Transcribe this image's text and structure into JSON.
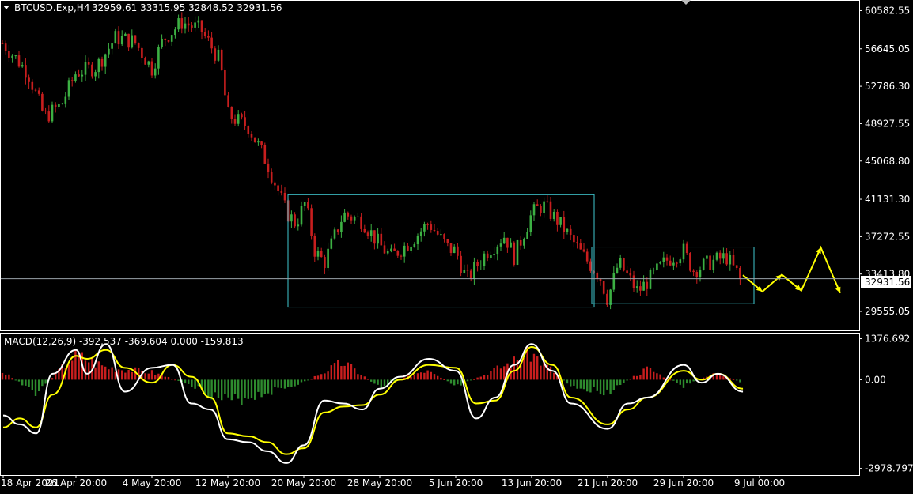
{
  "header": {
    "symbol_timeframe": "BTCUSD.Exp,H4",
    "ohlc": "32959.61 33315.95 32848.52 32931.56"
  },
  "macd_header": "MACD(12,26,9) -392.537 -369.604 0.000 -159.813",
  "current_price_label": "32931.56",
  "colors": {
    "background": "#000000",
    "up_candle": "#3cb043",
    "down_candle": "#c81e1e",
    "frame": "#ffffff",
    "box": "#40c8d0",
    "macd_main": "#ffffff",
    "macd_signal": "#ffff00",
    "hist_pos": "#c81e1e",
    "hist_neg": "#2e8b2e",
    "projection": "#ffff00"
  },
  "chart_data": [
    {
      "type": "candlestick",
      "title": "BTCUSD.Exp,H4",
      "ylim": [
        27600,
        61600
      ],
      "ytick_labels": [
        "60582.55",
        "56645.05",
        "52786.30",
        "48927.55",
        "45068.80",
        "41131.30",
        "37272.55",
        "33413.80",
        "29555.05"
      ],
      "ytick_values": [
        60582.55,
        56645.05,
        52786.3,
        48927.55,
        45068.8,
        41131.3,
        37272.55,
        33413.8,
        29555.05
      ],
      "current_price": 32931.56,
      "xtick_labels": [
        "18 Apr 2021",
        "26 Apr 20:00",
        "4 May 20:00",
        "12 May 20:00",
        "20 May 20:00",
        "28 May 20:00",
        "5 Jun 20:00",
        "13 Jun 20:00",
        "21 Jun 20:00",
        "29 Jun 20:00",
        "9 Jul 00:00"
      ],
      "close_path": [
        {
          "x": "18 Apr 2021",
          "y": 57200
        },
        {
          "x": "21 Apr",
          "y": 54200
        },
        {
          "x": "23 Apr",
          "y": 49600
        },
        {
          "x": "25 Apr",
          "y": 50800
        },
        {
          "x": "26 Apr 20:00",
          "y": 54200
        },
        {
          "x": "29 Apr",
          "y": 54800
        },
        {
          "x": "1 May",
          "y": 57800
        },
        {
          "x": "3 May",
          "y": 57400
        },
        {
          "x": "4 May 20:00",
          "y": 54600
        },
        {
          "x": "6 May",
          "y": 57600
        },
        {
          "x": "8 May",
          "y": 59400
        },
        {
          "x": "10 May",
          "y": 58600
        },
        {
          "x": "12 May",
          "y": 55400
        },
        {
          "x": "12 May 20:00",
          "y": 49800
        },
        {
          "x": "15 May",
          "y": 48600
        },
        {
          "x": "17 May",
          "y": 44800
        },
        {
          "x": "19 May",
          "y": 39800
        },
        {
          "x": "20 May",
          "y": 38600
        },
        {
          "x": "21 May",
          "y": 40800
        },
        {
          "x": "22 May",
          "y": 35800
        },
        {
          "x": "23 May",
          "y": 34600
        },
        {
          "x": "25 May",
          "y": 39600
        },
        {
          "x": "27 May",
          "y": 38900
        },
        {
          "x": "28 May 20:00",
          "y": 36400
        },
        {
          "x": "30 May",
          "y": 35200
        },
        {
          "x": "1 Jun",
          "y": 36700
        },
        {
          "x": "3 Jun",
          "y": 38700
        },
        {
          "x": "5 Jun",
          "y": 36100
        },
        {
          "x": "5 Jun 20:00",
          "y": 35800
        },
        {
          "x": "7 Jun",
          "y": 32800
        },
        {
          "x": "9 Jun",
          "y": 35600
        },
        {
          "x": "11 Jun",
          "y": 37400
        },
        {
          "x": "12 Jun",
          "y": 35200
        },
        {
          "x": "13 Jun 20:00",
          "y": 39600
        },
        {
          "x": "15 Jun",
          "y": 40600
        },
        {
          "x": "17 Jun",
          "y": 38400
        },
        {
          "x": "19 Jun",
          "y": 35600
        },
        {
          "x": "21 Jun",
          "y": 33200
        },
        {
          "x": "21 Jun 20:00",
          "y": 30800
        },
        {
          "x": "23 Jun",
          "y": 34600
        },
        {
          "x": "25 Jun",
          "y": 31600
        },
        {
          "x": "26 Jun",
          "y": 32600
        },
        {
          "x": "28 Jun",
          "y": 34800
        },
        {
          "x": "29 Jun 20:00",
          "y": 35800
        },
        {
          "x": "1 Jul",
          "y": 33800
        },
        {
          "x": "3 Jul",
          "y": 34600
        },
        {
          "x": "5 Jul",
          "y": 35200
        },
        {
          "x": "6 Jul",
          "y": 33800
        },
        {
          "x": "7 Jul",
          "y": 32931.56
        }
      ],
      "boxes": [
        {
          "from": "20 May 20:00",
          "to": "21 Jun",
          "top": 41600,
          "bottom": 30000
        },
        {
          "from": "21 Jun 20:00",
          "to": "9 Jul 00:00",
          "top": 36200,
          "bottom": 30350
        }
      ],
      "projection": [
        33300,
        31600,
        33350,
        31700,
        36150,
        31450
      ]
    },
    {
      "type": "line",
      "title": "MACD(12,26,9)",
      "ylim": [
        -3200,
        1550
      ],
      "ytick_labels": [
        "1376.692",
        "0.00",
        "-2978.797"
      ],
      "ytick_values": [
        1376.692,
        0,
        -2978.797
      ],
      "series": [
        {
          "name": "MACD",
          "x": [
            "18 Apr 2021",
            "20 Apr",
            "22 Apr",
            "24 Apr",
            "26 Apr 20:00",
            "28 Apr",
            "30 Apr",
            "2 May",
            "4 May 20:00",
            "7 May",
            "9 May",
            "11 May",
            "12 May 20:00",
            "15 May",
            "17 May",
            "19 May",
            "20 May 20:00",
            "23 May",
            "25 May",
            "27 May",
            "28 May 20:00",
            "31 May",
            "3 Jun",
            "5 Jun 20:00",
            "8 Jun",
            "10 Jun",
            "12 Jun",
            "13 Jun 20:00",
            "16 Jun",
            "18 Jun",
            "21 Jun 20:00",
            "24 Jun",
            "26 Jun",
            "29 Jun 20:00",
            "2 Jul",
            "4 Jul",
            "7 Jul"
          ],
          "values": [
            -1200,
            -1500,
            -1800,
            200,
            1000,
            200,
            1200,
            -400,
            400,
            500,
            -800,
            -1000,
            -2000,
            -2100,
            -2400,
            -2800,
            -2200,
            -700,
            -800,
            -1000,
            -300,
            100,
            700,
            300,
            -1300,
            -600,
            500,
            1200,
            300,
            -800,
            -1650,
            -800,
            -600,
            500,
            -100,
            200,
            -400
          ]
        },
        {
          "name": "Signal",
          "x": [
            "18 Apr 2021",
            "20 Apr",
            "22 Apr",
            "24 Apr",
            "26 Apr 20:00",
            "28 Apr",
            "30 Apr",
            "2 May",
            "4 May 20:00",
            "7 May",
            "9 May",
            "11 May",
            "12 May 20:00",
            "15 May",
            "17 May",
            "19 May",
            "20 May 20:00",
            "23 May",
            "25 May",
            "27 May",
            "28 May 20:00",
            "31 May",
            "3 Jun",
            "5 Jun 20:00",
            "8 Jun",
            "10 Jun",
            "12 Jun",
            "13 Jun 20:00",
            "16 Jun",
            "18 Jun",
            "21 Jun 20:00",
            "24 Jun",
            "26 Jun",
            "29 Jun 20:00",
            "2 Jul",
            "4 Jul",
            "7 Jul"
          ],
          "values": [
            -1600,
            -1300,
            -1600,
            -500,
            800,
            700,
            1000,
            400,
            -100,
            500,
            100,
            -600,
            -1800,
            -1900,
            -2100,
            -2500,
            -2300,
            -1100,
            -900,
            -850,
            -500,
            0,
            500,
            400,
            -800,
            -700,
            300,
            1100,
            500,
            -600,
            -1500,
            -1000,
            -600,
            300,
            0,
            200,
            -300
          ]
        },
        {
          "name": "Histogram",
          "x": [
            "18 Apr 2021",
            "22 Apr",
            "26 Apr 20:00",
            "30 Apr",
            "4 May 20:00",
            "9 May",
            "12 May 20:00",
            "17 May",
            "20 May 20:00",
            "25 May",
            "28 May 20:00",
            "3 Jun",
            "5 Jun 20:00",
            "10 Jun",
            "13 Jun 20:00",
            "18 Jun",
            "21 Jun 20:00",
            "26 Jun",
            "29 Jun 20:00",
            "4 Jul",
            "7 Jul"
          ],
          "values": [
            300,
            -500,
            1000,
            500,
            300,
            -200,
            -900,
            -500,
            -100,
            700,
            -300,
            450,
            -300,
            400,
            1050,
            -250,
            -500,
            450,
            -250,
            300,
            -150
          ]
        }
      ]
    }
  ]
}
